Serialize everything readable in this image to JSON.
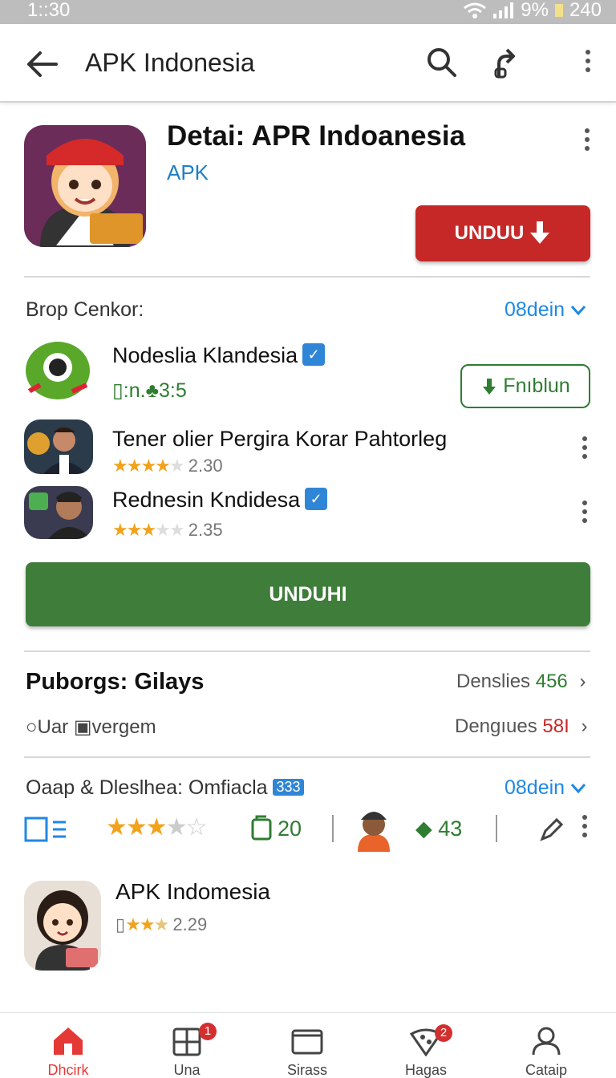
{
  "status_bar": {
    "time": "1::30",
    "battery": "9%",
    "extra": "240"
  },
  "app_bar": {
    "title": "APK Indonesia"
  },
  "hero": {
    "title": "Detai: APR Indoanesia",
    "subtitle": "APK",
    "download_label": "UNDUU"
  },
  "section1": {
    "label": "Brop Cenkor:",
    "link": "08dein",
    "items": [
      {
        "title": "Nodeslia Klandesia",
        "meta": ":n.",
        "rating": "3:5",
        "action": "Fnıblun"
      },
      {
        "title": "Tener olier Pergira Korar Pahtorleg",
        "rating": "2.30"
      },
      {
        "title": "Rednesin Kndidesa",
        "rating": "2.35"
      }
    ],
    "main_button": "UNDUHI"
  },
  "stats": {
    "title": "Puborgs: Gilays",
    "line1_label": "Denslies",
    "line1_value": "456",
    "filter_left_a": "Uar",
    "filter_left_b": "vergem",
    "line2_label": "Dengıues",
    "line2_value": "58I"
  },
  "section2": {
    "label": "Oaap  & Dleslhea: Omfiacla",
    "badge": "333",
    "link": "08dein",
    "count_a": "20",
    "count_b": "43"
  },
  "app_item": {
    "title": "APK Indomesia",
    "rating": "2.29"
  },
  "bottom_nav": [
    {
      "label": "Dhcirk"
    },
    {
      "label": "Una",
      "badge": "1"
    },
    {
      "label": "Sirass"
    },
    {
      "label": "Hagas",
      "badge": "2"
    },
    {
      "label": "Cataip"
    }
  ],
  "colors": {
    "accent_red": "#c62828",
    "accent_green": "#3f7d3a",
    "link_blue": "#1e88e5"
  }
}
